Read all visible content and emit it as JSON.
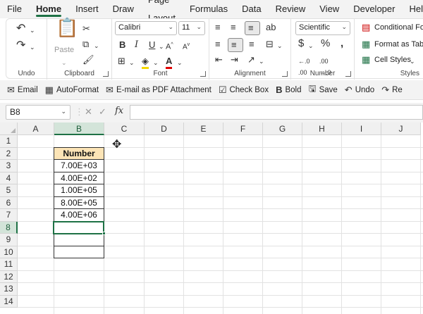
{
  "menu": [
    "File",
    "Home",
    "Insert",
    "Draw",
    "Page Layout",
    "Formulas",
    "Data",
    "Review",
    "View",
    "Developer",
    "Help"
  ],
  "active_menu": "Home",
  "ribbon": {
    "undo_group": "Undo",
    "clipboard_group": "Clipboard",
    "paste_label": "Paste",
    "font_group": "Font",
    "font_name": "Calibri",
    "font_size": "11",
    "alignment_group": "Alignment",
    "number_group": "Number",
    "number_format": "Scientific",
    "styles_group": "Styles",
    "conditional_formatting": "Conditional Fo",
    "format_as_table": "Format as Table",
    "cell_styles": "Cell Styles"
  },
  "quick_toolbar": [
    {
      "icon": "✉",
      "label": "Email",
      "name": "email-button"
    },
    {
      "icon": "▦",
      "label": "AutoFormat",
      "name": "autoformat-button"
    },
    {
      "icon": "✉",
      "label": "E-mail as PDF Attachment",
      "name": "email-pdf-button"
    },
    {
      "icon": "☑",
      "label": "Check Box",
      "name": "check-box-button"
    },
    {
      "icon": "B",
      "label": "Bold",
      "name": "bold-qat-button"
    },
    {
      "icon": "🖫",
      "label": "Save",
      "name": "save-button"
    },
    {
      "icon": "↶",
      "label": "Undo",
      "name": "undo-qat-button"
    },
    {
      "icon": "↷",
      "label": "Re",
      "name": "redo-qat-button"
    }
  ],
  "formula_bar": {
    "name_box": "B8",
    "formula": ""
  },
  "columns": [
    "A",
    "B",
    "C",
    "D",
    "E",
    "F",
    "G",
    "H",
    "I",
    "J"
  ],
  "rows": [
    "1",
    "2",
    "3",
    "4",
    "5",
    "6",
    "7",
    "8",
    "9",
    "10",
    "11",
    "12",
    "13",
    "14"
  ],
  "selected_column": "B",
  "selected_row": "8",
  "table": {
    "header": "Number",
    "values": [
      "7.00E+03",
      "4.00E+02",
      "1.00E+05",
      "8.00E+05",
      "4.00E+06"
    ]
  }
}
